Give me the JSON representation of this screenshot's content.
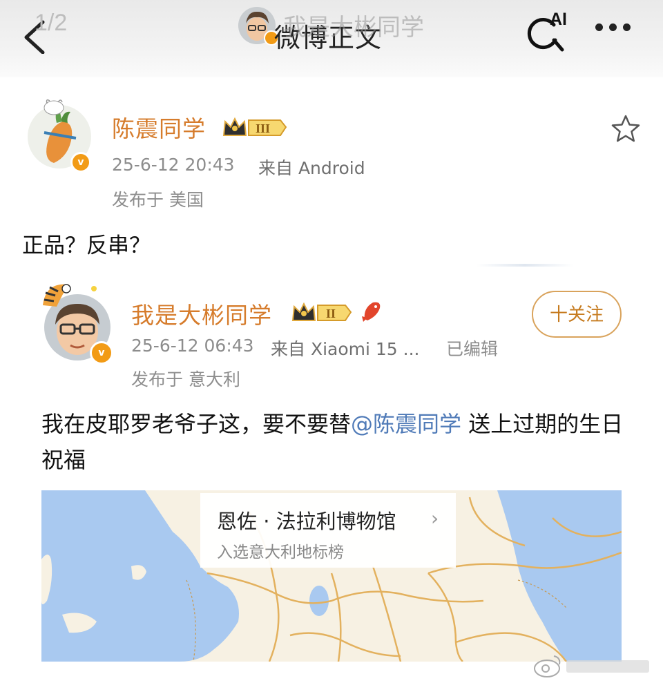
{
  "header": {
    "page_counter": "1/2",
    "title": "微博正文",
    "ghost_user": "我是大彬同学",
    "ai_label": "AI"
  },
  "post": {
    "author": "陈震同学",
    "level": "III",
    "time": "25-6-12 20:43",
    "source": "来自 Android",
    "location": "发布于 美国",
    "text": "正品？反串？"
  },
  "repost": {
    "author": "我是大彬同学",
    "level": "II",
    "time": "25-6-12 06:43",
    "source": "来自 Xiaomi 15 ...",
    "edited": "已编辑",
    "location": "发布于 意大利",
    "follow_label": "十关注",
    "text_before": "我在皮耶罗老爷子这，要不要替",
    "mention": "@陈震同学",
    "text_after": " 送上过期的生日祝福"
  },
  "map_card": {
    "place_name": "恩佐 · 法拉利博物馆",
    "place_subtitle": "入选意大利地标榜",
    "chevron": "›"
  },
  "colors": {
    "brand_orange": "#d67c2c",
    "mention_blue": "#507bb8",
    "verified_badge": "#f29b16",
    "sea": "#a9c9f0",
    "land": "#f7f1e3",
    "road": "#e3b15e"
  }
}
